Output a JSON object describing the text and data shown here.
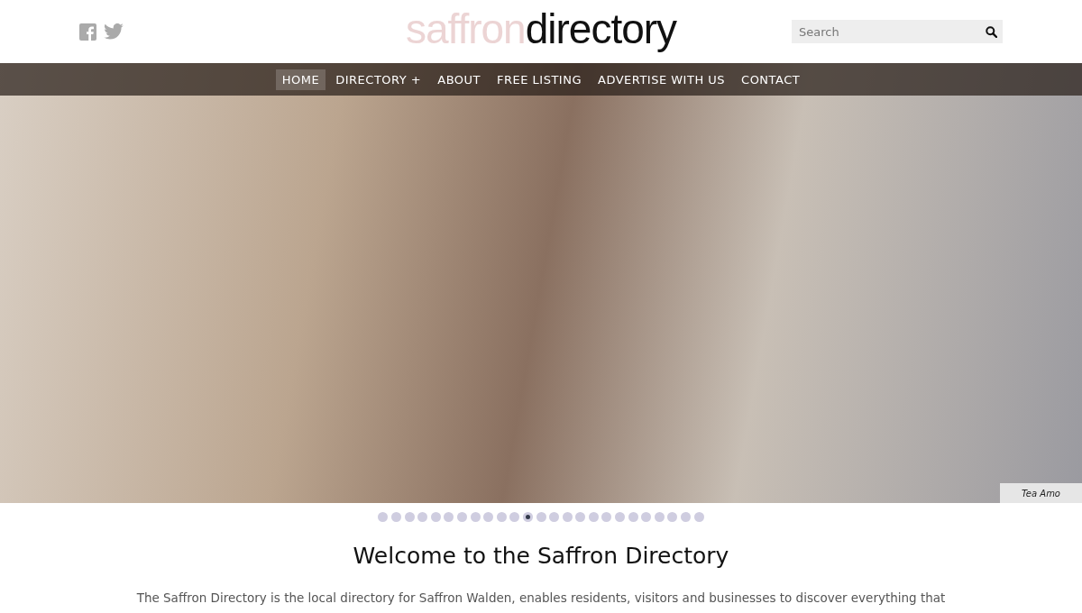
{
  "header": {
    "social": [
      {
        "kind": "facebook"
      },
      {
        "kind": "twitter"
      }
    ],
    "logo": {
      "light": "saffron",
      "dark": "directory"
    },
    "search": {
      "placeholder": "Search"
    }
  },
  "nav": {
    "items": [
      {
        "label": "HOME",
        "selected": true
      },
      {
        "label": "DIRECTORY +",
        "selected": false
      },
      {
        "label": "ABOUT",
        "selected": false
      },
      {
        "label": "FREE LISTING",
        "selected": false
      },
      {
        "label": "ADVERTISE WITH US",
        "selected": false
      },
      {
        "label": "CONTACT",
        "selected": false
      }
    ]
  },
  "hero": {
    "caption": "Tea Amo"
  },
  "slider_dots": [
    {
      "selected": false
    },
    {
      "selected": false
    },
    {
      "selected": false
    },
    {
      "selected": false
    },
    {
      "selected": false
    },
    {
      "selected": false
    },
    {
      "selected": false
    },
    {
      "selected": false
    },
    {
      "selected": false
    },
    {
      "selected": false
    },
    {
      "selected": false
    },
    {
      "selected": true
    },
    {
      "selected": false
    },
    {
      "selected": false
    },
    {
      "selected": false
    },
    {
      "selected": false
    },
    {
      "selected": false
    },
    {
      "selected": false
    },
    {
      "selected": false
    },
    {
      "selected": false
    },
    {
      "selected": false
    },
    {
      "selected": false
    },
    {
      "selected": false
    },
    {
      "selected": false
    },
    {
      "selected": false
    }
  ],
  "welcome": {
    "title": "Welcome to the Saffron Directory",
    "text": "The Saffron Directory is the local directory for Saffron Walden, enables residents, visitors and businesses to discover everything that"
  }
}
